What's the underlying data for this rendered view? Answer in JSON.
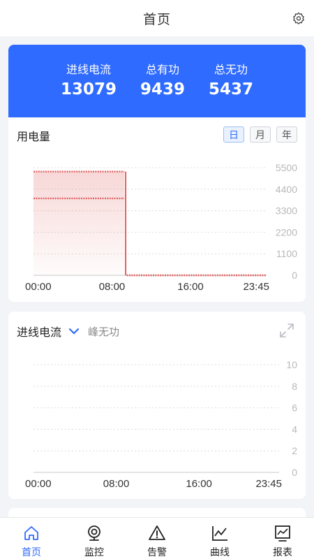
{
  "header": {
    "title": "首页"
  },
  "hero": {
    "metrics": [
      {
        "label": "进线电流",
        "value": "13079"
      },
      {
        "label": "总有功",
        "value": "9439"
      },
      {
        "label": "总无功",
        "value": "5437"
      }
    ]
  },
  "energy_card": {
    "title": "用电量",
    "periods": [
      "日",
      "月",
      "年"
    ],
    "active_period": "日"
  },
  "current_card": {
    "selected": "进线电流",
    "secondary": "峰无功"
  },
  "tabs": [
    {
      "label": "首页",
      "icon": "home-icon",
      "active": true
    },
    {
      "label": "监控",
      "icon": "camera-icon",
      "active": false
    },
    {
      "label": "告警",
      "icon": "warning-icon",
      "active": false
    },
    {
      "label": "曲线",
      "icon": "line-chart-icon",
      "active": false
    },
    {
      "label": "报表",
      "icon": "report-icon",
      "active": false
    }
  ],
  "colors": {
    "accent": "#2f6bff",
    "series": "#e06060"
  },
  "chart_data": [
    {
      "type": "line",
      "x_ticks": [
        "00:00",
        "08:00",
        "16:00",
        "23:45"
      ],
      "ylim": [
        0,
        5500
      ],
      "y_ticks": [
        "5500",
        "4400",
        "3300",
        "2200",
        "1100",
        "0"
      ],
      "series": [
        {
          "values_hours": [
            0,
            9.25
          ],
          "values": [
            5300,
            5300
          ]
        },
        {
          "values_hours": [
            0,
            9.25
          ],
          "values": [
            3930,
            3930
          ]
        },
        {
          "values_hours": [
            9.5,
            23.75
          ],
          "values": [
            0,
            0
          ]
        }
      ]
    },
    {
      "type": "line",
      "x_ticks": [
        "00:00",
        "08:00",
        "16:00",
        "23:45"
      ],
      "ylim": [
        0,
        10
      ],
      "y_ticks": [
        "10",
        "8",
        "6",
        "4",
        "2",
        "0"
      ],
      "series": []
    }
  ]
}
